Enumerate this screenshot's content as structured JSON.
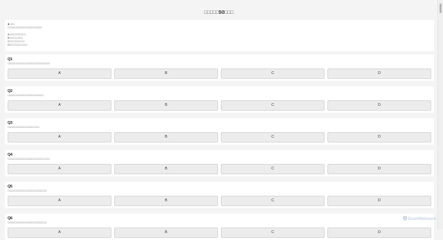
{
  "page": {
    "title_prefix": "□□□□□",
    "title_number": "50",
    "title_suffix": "□□□"
  },
  "intro": {
    "bullet": "●",
    "heading": "□□□",
    "description": "□□□□□□□□□□□□□□□□□□□□□□□",
    "legend": [
      "A□□□□□□□□□□□",
      "B□□□□□□□□□",
      "C□□□□□□□□□□",
      "D□□□□□□□□□□□□"
    ]
  },
  "questions": [
    {
      "label": "Q1",
      "text": "□□□□□□□□□□□□□□□□□□□□□□□□□□□□",
      "options": [
        "A",
        "B",
        "C",
        "D"
      ]
    },
    {
      "label": "Q2",
      "text": "□□□□□□□□□□□□□□□□□□□□□□□□",
      "options": [
        "A",
        "B",
        "C",
        "D"
      ]
    },
    {
      "label": "Q3",
      "text": "□□□□□□□□□□□□□□□□□□□□□",
      "options": [
        "A",
        "B",
        "C",
        "D"
      ]
    },
    {
      "label": "Q4",
      "text": "□□□□□□□□□□□□□□□□□□□□□□□□□□□□",
      "options": [
        "A",
        "B",
        "C",
        "D"
      ]
    },
    {
      "label": "Q5",
      "text": "□□□□□□□□□□□□□□□□□□□□□□□□□□",
      "options": [
        "A",
        "B",
        "C",
        "D"
      ]
    },
    {
      "label": "Q6",
      "text": "□□□□□□□□□□□□□□□□□□□□□□□□□□",
      "options": [
        "A",
        "B",
        "C",
        "D"
      ]
    }
  ],
  "watermark": {
    "text": "ScanMalware",
    "icon": "shield-icon"
  },
  "colors": {
    "background": "#f4f4f4",
    "card": "#ffffff",
    "option_bg": "#ececec",
    "option_border": "#d6d6d6"
  }
}
